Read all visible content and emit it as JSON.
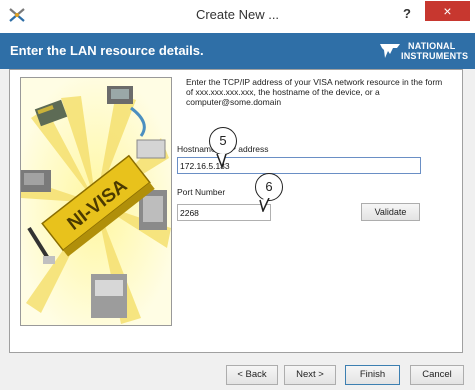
{
  "window": {
    "title": "Create New ...",
    "help_label": "?",
    "close_label": "×"
  },
  "header": {
    "text": "Enter the LAN resource details.",
    "logo": {
      "line1": "NATIONAL",
      "line2": "INSTRUMENTS"
    }
  },
  "form": {
    "description": "Enter the TCP/IP address of your VISA network resource in the form of xxx.xxx.xxx.xxx, the hostname of the device, or a computer@some.domain",
    "hostname_label": "Hostname or IP address",
    "hostname_value": "172.16.5.133",
    "port_label": "Port Number",
    "port_value": "2268",
    "validate_label": "Validate"
  },
  "image": {
    "banner_text": "NI-VISA"
  },
  "callouts": {
    "hostname": "5",
    "port": "6"
  },
  "footer": {
    "back_label": "< Back",
    "next_label": "Next >",
    "finish_label": "Finish",
    "cancel_label": "Cancel"
  },
  "colors": {
    "header_band": "#2f6fa7",
    "close_button": "#c7372f",
    "image_background": "#fffde4"
  }
}
